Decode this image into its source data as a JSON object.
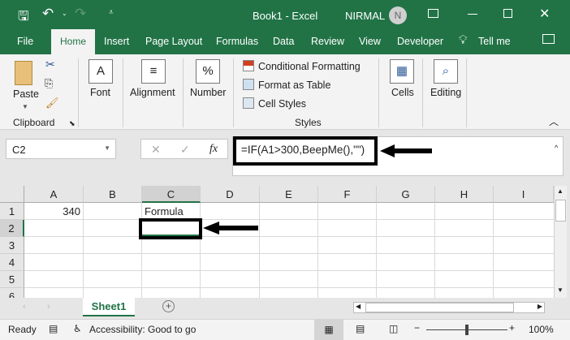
{
  "title_bar": {
    "doc_title": "Book1  -  Excel",
    "user_name": "NIRMAL",
    "avatar_initial": "N"
  },
  "tabs": [
    "File",
    "Home",
    "Insert",
    "Page Layout",
    "Formulas",
    "Data",
    "Review",
    "View",
    "Developer"
  ],
  "tell_me": "Tell me",
  "ribbon": {
    "paste": "Paste",
    "clipboard": "Clipboard",
    "font": "Font",
    "alignment": "Alignment",
    "number": "Number",
    "conditional_formatting": "Conditional Formatting",
    "format_as_table": "Format as Table",
    "cell_styles": "Cell Styles",
    "styles": "Styles",
    "cells": "Cells",
    "editing": "Editing"
  },
  "formula_bar": {
    "name_box": "C2",
    "fx": "fx",
    "formula": "=IF(A1>300,BeepMe(),\"\")"
  },
  "columns": [
    "A",
    "B",
    "C",
    "D",
    "E",
    "F",
    "G",
    "H",
    "I"
  ],
  "rows": [
    "1",
    "2",
    "3",
    "4",
    "5",
    "6"
  ],
  "cells": {
    "A1": "340",
    "C1": "Formula"
  },
  "sheet_tab": "Sheet1",
  "status": {
    "ready": "Ready",
    "accessibility": "Accessibility: Good to go",
    "zoom": "100%"
  },
  "colors": {
    "brand": "#217346"
  }
}
